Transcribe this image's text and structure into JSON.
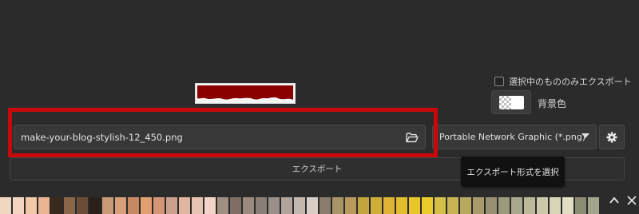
{
  "export_panel": {
    "selection_only_label": "選択中のもののみエクスポート",
    "background_color_label": "背景色",
    "file_name": "make-your-blog-stylish-12_450.png",
    "format_value": "Portable Network Graphic (*.png)",
    "export_button_label": "エクスポート",
    "tooltip_text": "エクスポート形式を選択",
    "highlight_color": "#c8080a"
  },
  "icons": {
    "folder": "folder-open-icon",
    "dropdown": "chevron-down-icon",
    "settings": "gear-icon",
    "collapse": "chevron-up-icon",
    "close": "close-icon"
  },
  "palette": {
    "colors": [
      "#f0d8c0",
      "#f2d6c2",
      "#f1c9a9",
      "#e9b48f",
      "#3a2a1e",
      "#8a6648",
      "#6a4d36",
      "#2a2019",
      "#c89a78",
      "#d8a07a",
      "#c88a64",
      "#e0a070",
      "#d49676",
      "#caa08c",
      "#e0b6a0",
      "#e6c4b4",
      "#f4d4c8",
      "#a08e82",
      "#7e6e64",
      "#9a8a80",
      "#8a8078",
      "#9a9088",
      "#b0a49a",
      "#c4b8ae",
      "#d8cec6",
      "#8a7c6c",
      "#a89464",
      "#b89a5c",
      "#c4a43e",
      "#d0ac38",
      "#dcb432",
      "#e2be2e",
      "#e8c62c",
      "#eccc2a",
      "#d4c048",
      "#c8b454",
      "#b8a860",
      "#a89a6a",
      "#989070",
      "#9c9a7c",
      "#aaa88c",
      "#bcb89a",
      "#ccc8aa",
      "#d8d4b8",
      "#e2dec4",
      "#8c8c74",
      "#a4a48c"
    ]
  }
}
